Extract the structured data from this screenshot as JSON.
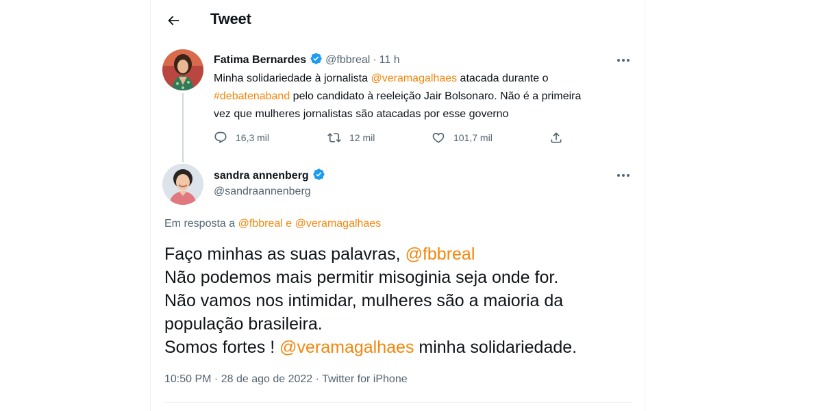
{
  "header": {
    "title": "Tweet"
  },
  "original_tweet": {
    "author_name": "Fatima Bernardes",
    "handle": "@fbbreal",
    "separator": "·",
    "time_ago": "11 h",
    "text_parts": {
      "t1": "Minha solidariedade à jornalista ",
      "m1": "@veramagalhaes",
      "t2": " atacada durante o",
      "h1": "#debatenaband",
      "t3": " pelo candidato à reeleição Jair Bolsonaro. Não é a primeira",
      "t4": "vez que mulheres jornalistas são atacadas por esse governo"
    },
    "stats": {
      "replies": "16,3 mil",
      "retweets": "12 mil",
      "likes": "101,7 mil"
    }
  },
  "reply_tweet": {
    "author_name": "sandra annenberg",
    "handle": "@sandraannenberg",
    "replying_to": {
      "prefix": "Em resposta a ",
      "user1": "@fbbreal",
      "conj": " e ",
      "user2": "@veramagalhaes"
    },
    "lines": {
      "l1a": "Faço minhas as suas palavras, ",
      "l1m": "@fbbreal",
      "l2": "Não podemos mais permitir misoginia seja onde for.",
      "l3": "Não vamos nos intimidar, mulheres são a maioria da",
      "l4": "população brasileira.",
      "l5a": "Somos fortes ! ",
      "l5m": "@veramagalhaes",
      "l5b": " minha solidariedade."
    },
    "timestamp": {
      "time": "10:50 PM",
      "sep": " · ",
      "date": "28 de ago de 2022",
      "sep2": " · ",
      "source": "Twitter for iPhone"
    }
  },
  "colors": {
    "link": "#f4860b",
    "verified": "#1d9bf0",
    "secondary": "#536471"
  },
  "icons": [
    "back-arrow-icon",
    "verified-badge-icon",
    "more-icon",
    "reply-icon",
    "retweet-icon",
    "like-icon",
    "share-icon"
  ]
}
